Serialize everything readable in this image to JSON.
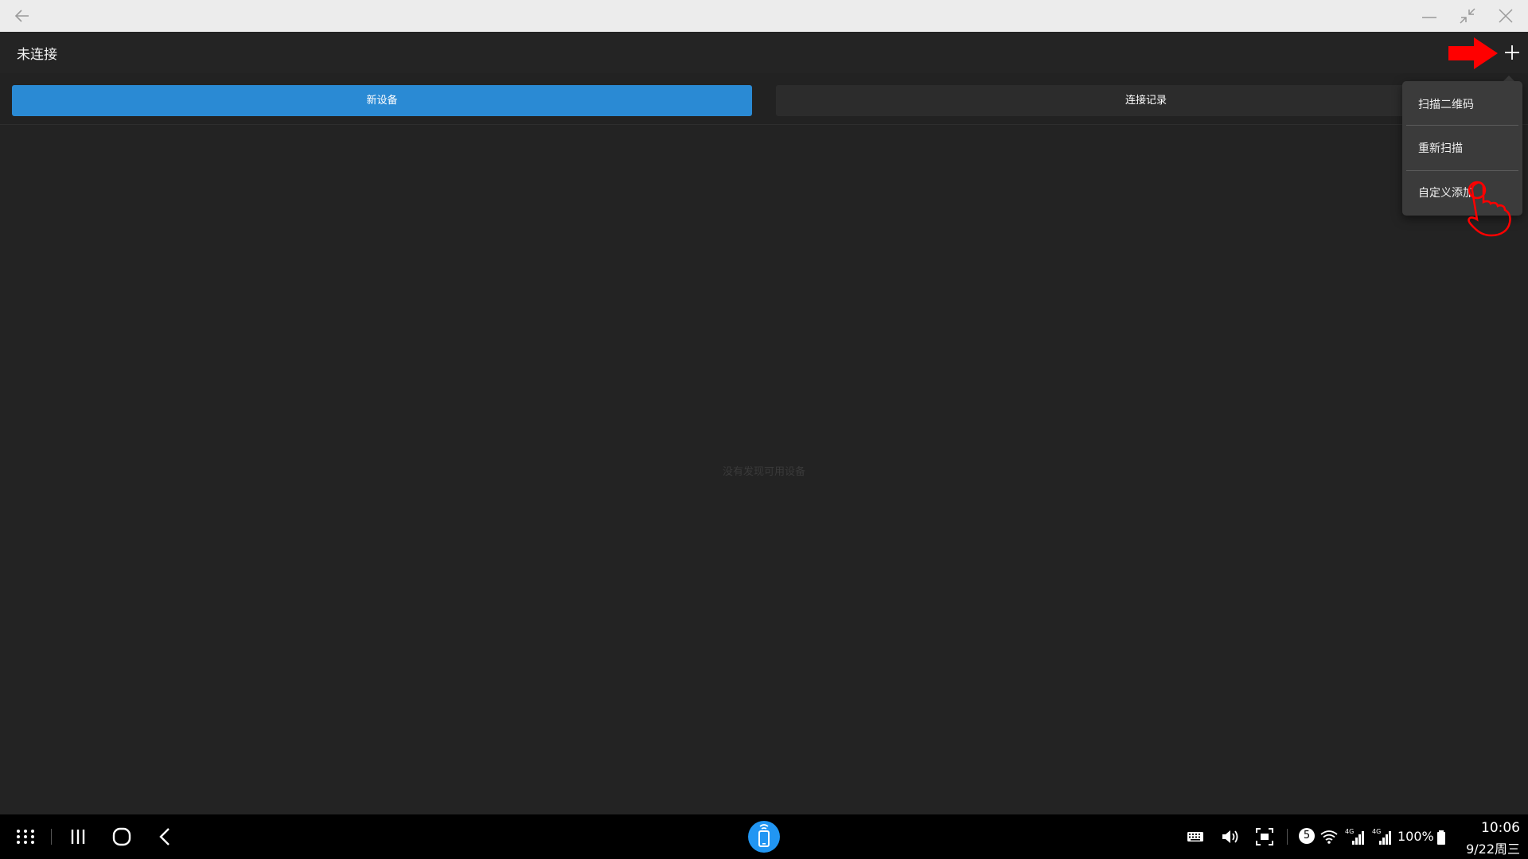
{
  "window": {
    "back_icon": "arrow-left-icon",
    "minimize_icon": "minimize-icon",
    "restore_icon": "restore-icon",
    "close_icon": "close-icon"
  },
  "appbar": {
    "title": "未连接",
    "add_icon": "plus-icon"
  },
  "tabs": [
    {
      "label": "新设备",
      "selected": true,
      "color": "#2a8ad4"
    },
    {
      "label": "连接记录",
      "selected": false,
      "color": "#2c2c2c"
    }
  ],
  "main": {
    "empty_message": "没有发现可用设备"
  },
  "dropdown": {
    "items": [
      {
        "label": "扫描二维码"
      },
      {
        "label": "重新扫描"
      },
      {
        "label": "自定义添加"
      }
    ]
  },
  "annotations": {
    "arrow_color": "#ff0000",
    "hand_icon": "pointing-hand-icon"
  },
  "taskbar": {
    "apps_icon": "apps-grid-icon",
    "recents_icon": "recents-icon",
    "home_icon": "home-icon",
    "back_icon": "back-chevron-icon",
    "app_icon": "phone-connect-icon",
    "keyboard_icon": "keyboard-icon",
    "volume_icon": "volume-icon",
    "screenshot_icon": "screen-capture-icon",
    "notification_count": "5",
    "wifi_icon": "wifi-icon",
    "signal1_label": "4G",
    "signal2_label": "4G",
    "battery": "100%",
    "time": "10:06",
    "date": "9/22周三"
  }
}
